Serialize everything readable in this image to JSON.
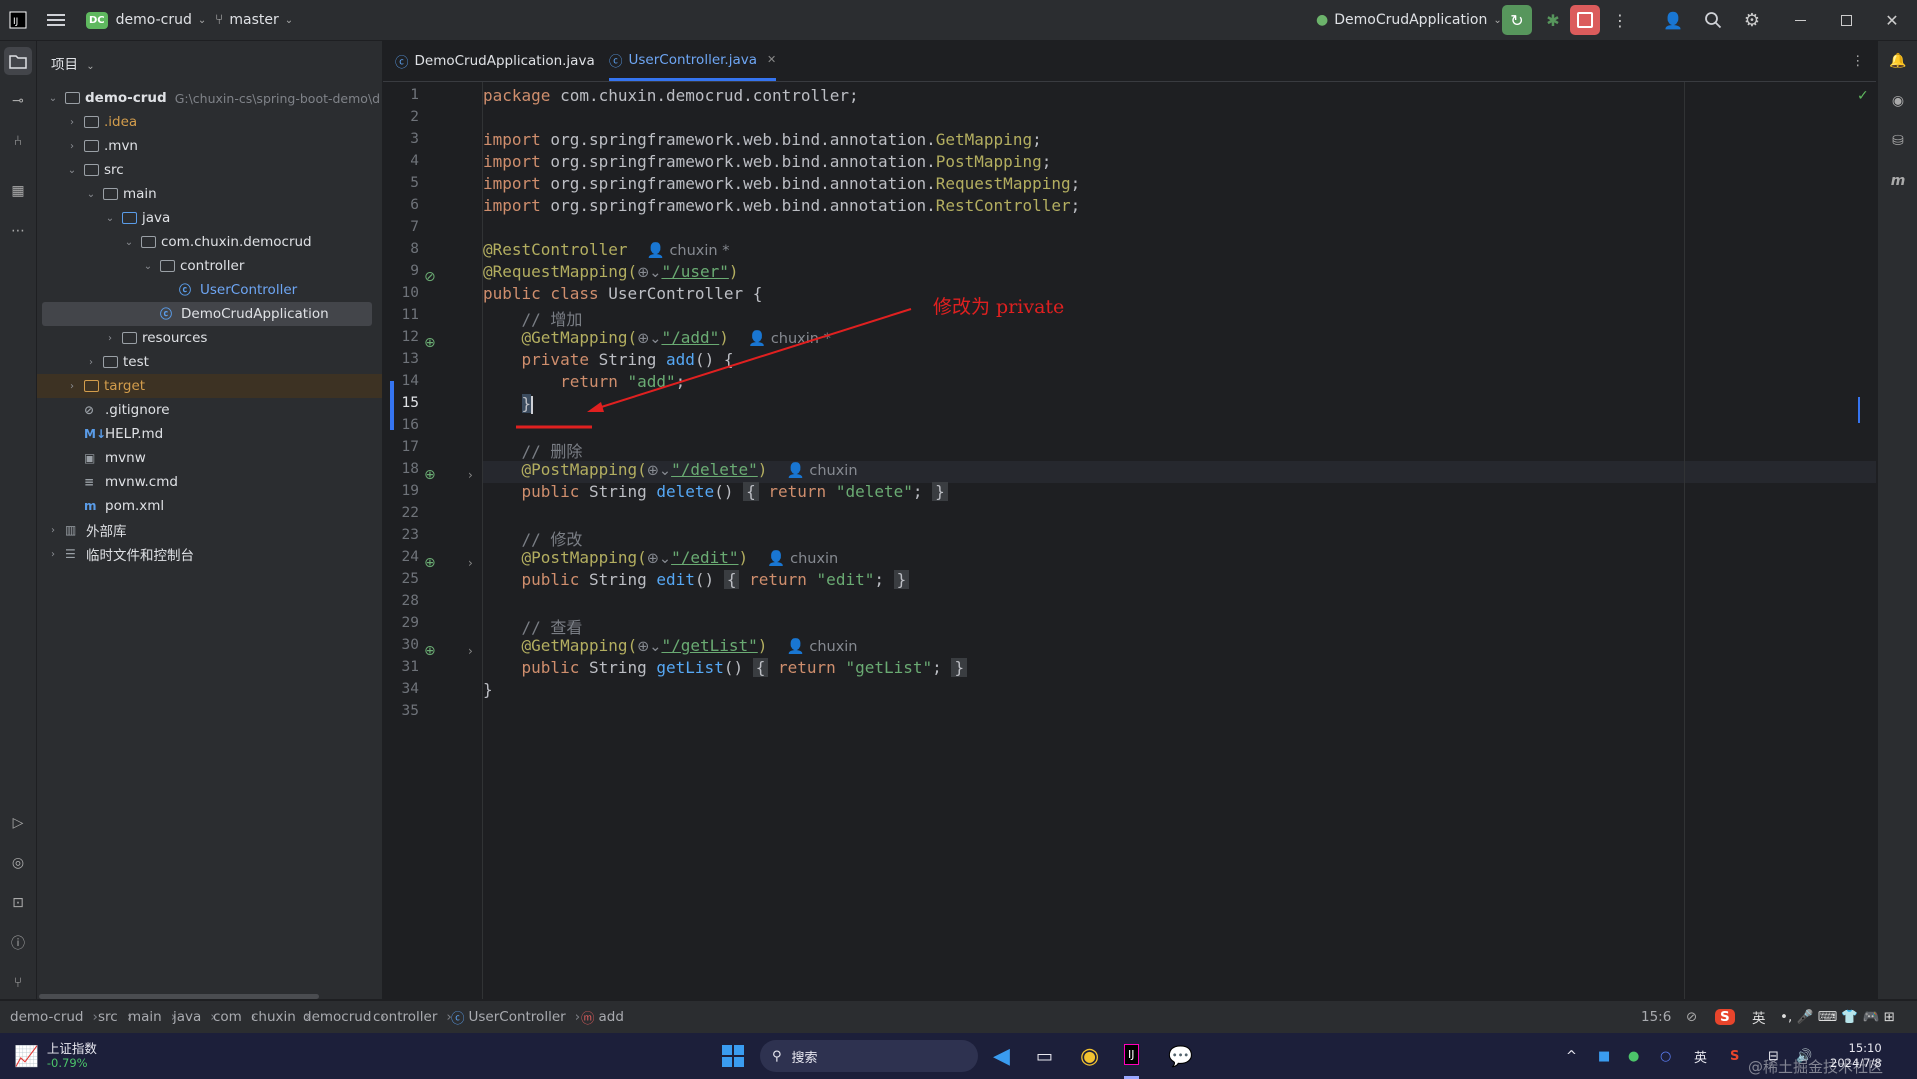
{
  "titlebar": {
    "app_badge": "DC",
    "project": "demo-crud",
    "branch": "master",
    "run_config": "DemoCrudApplication"
  },
  "project_panel": {
    "header": "项目",
    "tree": [
      {
        "label": "demo-crud",
        "path": "G:\\chuxin-cs\\spring-boot-demo\\d",
        "depth": 0,
        "chev": "v",
        "icon": "folder-icon"
      },
      {
        "label": ".idea",
        "depth": 1,
        "chev": ">",
        "icon": "folder-icon"
      },
      {
        "label": ".mvn",
        "depth": 1,
        "chev": ">",
        "icon": "folder-icon"
      },
      {
        "label": "src",
        "depth": 1,
        "chev": "v",
        "icon": "folder-icon"
      },
      {
        "label": "main",
        "depth": 2,
        "chev": "v",
        "icon": "folder-icon"
      },
      {
        "label": "java",
        "depth": 3,
        "chev": "v",
        "icon": "folder-icon"
      },
      {
        "label": "com.chuxin.democrud",
        "depth": 4,
        "chev": "v",
        "icon": "folder-icon"
      },
      {
        "label": "controller",
        "depth": 5,
        "chev": "v",
        "icon": "folder-icon"
      },
      {
        "label": "UserController",
        "depth": 6,
        "chev": "",
        "icon": "class-icon"
      },
      {
        "label": "DemoCrudApplication",
        "depth": 5,
        "chev": "",
        "icon": "spring-class-icon"
      },
      {
        "label": "resources",
        "depth": 3,
        "chev": ">",
        "icon": "folder-icon"
      },
      {
        "label": "test",
        "depth": 2,
        "chev": ">",
        "icon": "folder-icon"
      },
      {
        "label": "target",
        "depth": 1,
        "chev": ">",
        "icon": "folder-icon"
      },
      {
        "label": ".gitignore",
        "depth": 1,
        "chev": "",
        "icon": "ignore-file-icon"
      },
      {
        "label": "HELP.md",
        "depth": 1,
        "chev": "",
        "icon": "markdown-icon"
      },
      {
        "label": "mvnw",
        "depth": 1,
        "chev": "",
        "icon": "script-icon"
      },
      {
        "label": "mvnw.cmd",
        "depth": 1,
        "chev": "",
        "icon": "text-file-icon"
      },
      {
        "label": "pom.xml",
        "depth": 1,
        "chev": "",
        "icon": "maven-icon"
      },
      {
        "label": "外部库",
        "depth": 0,
        "chev": ">",
        "icon": "library-icon"
      },
      {
        "label": "临时文件和控制台",
        "depth": 0,
        "chev": ">",
        "icon": "scratch-icon"
      }
    ]
  },
  "tabs": [
    {
      "label": "DemoCrudApplication.java"
    },
    {
      "label": "UserController.java"
    }
  ],
  "code": {
    "line_numbers": [
      "1",
      "2",
      "3",
      "4",
      "5",
      "6",
      "7",
      "8",
      "9",
      "10",
      "11",
      "12",
      "13",
      "14",
      "15",
      "16",
      "17",
      "18",
      "19",
      "22",
      "23",
      "24",
      "25",
      "28",
      "29",
      "30",
      "31",
      "34",
      "35"
    ],
    "l1_pkg": "package",
    "l1_rest": " com.chuxin.democrud.controller;",
    "imp": "import",
    "imp_prefix": " org.springframework.web.bind.annotation.",
    "imp_names": [
      "GetMapping",
      "PostMapping",
      "RequestMapping",
      "RestController"
    ],
    "semi": ";",
    "ann_rest": "@RestController",
    "author": "chuxin",
    "author_mod": "chuxin *",
    "ann_reqmap": "@RequestMapping(",
    "path_user": "\"/user\"",
    "close_paren": ")",
    "class_decl_kw": "public class",
    "class_decl_rest": " UserController {",
    "c_add": "// 增加",
    "ann_get": "@GetMapping(",
    "ann_post": "@PostMapping(",
    "path_add": "\"/add\"",
    "kw_private": "private",
    "kw_public": "public",
    "ret_type": " String ",
    "m_add": "add",
    "paren_brace": "() {",
    "paren": "()",
    "kw_return": "return",
    "s_add": "\"add\"",
    "close_brace": "}",
    "c_delete": "// 删除",
    "path_delete": "\"/delete\"",
    "m_delete": "delete",
    "s_delete": "\"delete\"",
    "c_edit": "// 修改",
    "path_edit": "\"/edit\"",
    "m_edit": "edit",
    "s_edit": "\"edit\"",
    "c_list": "// 查看",
    "path_list": "\"/getList\"",
    "m_list": "getList",
    "s_list": "\"getList\"",
    "fold_open": "{",
    "fold_close": "}"
  },
  "annotation_text": "修改为 private",
  "status": {
    "crumbs": [
      "demo-crud",
      "src",
      "main",
      "java",
      "com",
      "chuxin",
      "democrud",
      "controller",
      "UserController",
      "add"
    ],
    "position": "15:6"
  },
  "taskbar": {
    "stock_name": "上证指数",
    "stock_change": "-0.79%",
    "search": "搜索",
    "ime": "英",
    "time": "15:10",
    "date": "2024/7/8",
    "watermark": "@稀土掘金技术社区"
  },
  "colors": {
    "accent": "#3574f0",
    "annotation_red": "#e02020",
    "run_green": "#57965c",
    "stop_red": "#db5c5c"
  }
}
